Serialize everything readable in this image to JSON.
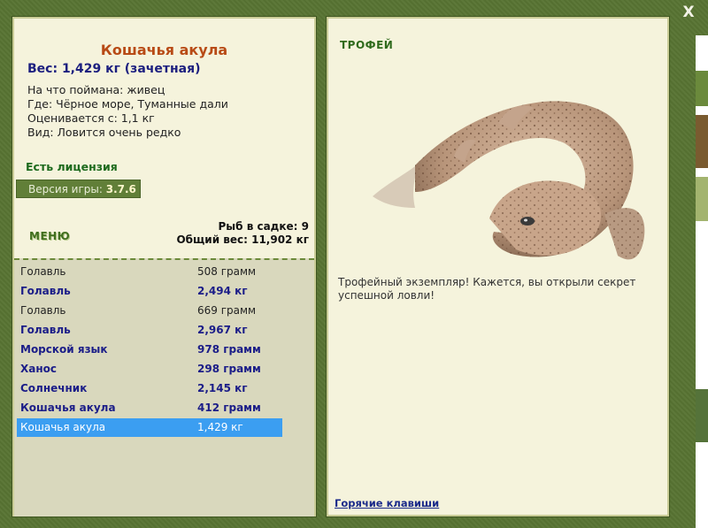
{
  "window": {
    "close_label": "X"
  },
  "fish_info": {
    "name": "Кошачья акула",
    "weight": "Вес: 1,429 кг (зачетная)",
    "bait": "На что поймана: живец",
    "location": "Где: Чёрное море, Туманные дали",
    "price": "Оценивается с: 1,1 кг",
    "rarity": "Вид: Ловится очень редко"
  },
  "license": "Есть лицензия",
  "version": {
    "label": "Версия игры:",
    "value": "3.7.6"
  },
  "menu_label": "МЕНЮ",
  "summary": {
    "fish_count": "Рыб в садке: 9",
    "total_weight": "Общий вес: 11,902 кг"
  },
  "catch_list": [
    {
      "name": "Голавль",
      "weight": "508 грамм",
      "style": "normal"
    },
    {
      "name": "Голавль",
      "weight": "2,494 кг",
      "style": "bold"
    },
    {
      "name": "Голавль",
      "weight": "669 грамм",
      "style": "normal"
    },
    {
      "name": "Голавль",
      "weight": "2,967 кг",
      "style": "bold"
    },
    {
      "name": "Морской язык",
      "weight": "978 грамм",
      "style": "bold"
    },
    {
      "name": "Ханос",
      "weight": "298 грамм",
      "style": "bold"
    },
    {
      "name": "Солнечник",
      "weight": "2,145 кг",
      "style": "bold"
    },
    {
      "name": "Кошачья акула",
      "weight": "412 грамм",
      "style": "bold"
    },
    {
      "name": "Кошачья акула",
      "weight": "1,429 кг",
      "style": "selected"
    }
  ],
  "trophy": {
    "label": "ТРОФЕЙ",
    "text": "Трофейный экземпляр! Кажется, вы открыли секрет успешной ловли!",
    "image_icon": "shark-image"
  },
  "hotkeys_link": "Горячие клавиши",
  "colors": {
    "frame": "#587433",
    "panel": "#f5f3dc",
    "list_bg": "#d9d8bd",
    "selected": "#3b9ef1",
    "title": "#b84b16",
    "bold_row": "#1b1d88"
  }
}
